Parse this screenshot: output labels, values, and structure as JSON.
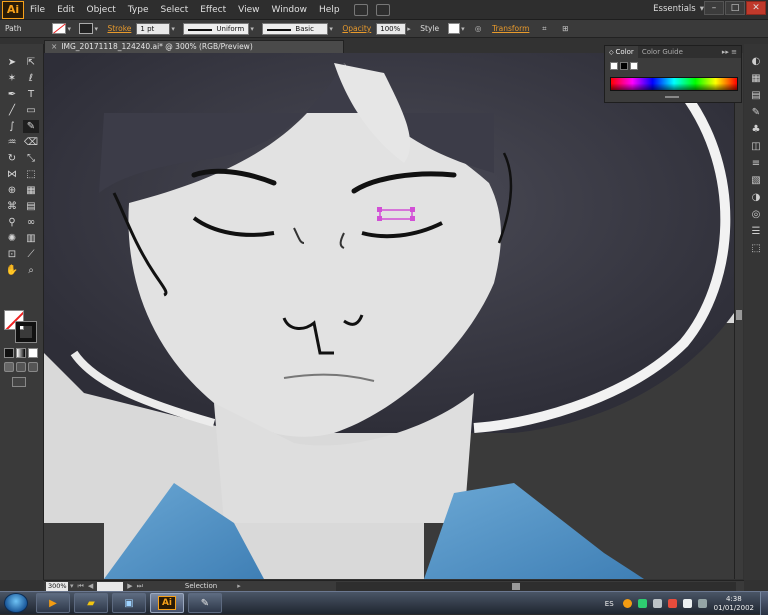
{
  "app": {
    "logo": "Ai",
    "menu": [
      "File",
      "Edit",
      "Object",
      "Type",
      "Select",
      "Effect",
      "View",
      "Window",
      "Help"
    ],
    "workspace": "Essentials",
    "window_buttons": [
      "–",
      "□",
      "✕"
    ]
  },
  "control_bar": {
    "object_type": "Path",
    "stroke_label": "Stroke",
    "stroke_weight": "1 pt",
    "profile": "Uniform",
    "brush": "Basic",
    "opacity_label": "Opacity",
    "opacity_value": "100%",
    "style_label": "Style",
    "transform_label": "Transform"
  },
  "document": {
    "tab_title": "IMG_20171118_124240.ai* @ 300% (RGB/Preview)",
    "close_glyph": "×"
  },
  "color_panel": {
    "tabs": [
      "Color",
      "Color Guide"
    ],
    "active_tab": "Color",
    "panel_controls": "▸▸ ≡"
  },
  "status_bar": {
    "zoom": "300%",
    "status_text": "Selection"
  },
  "taskbar": {
    "apps": [
      "media-player-icon",
      "file-explorer-icon",
      "screen-tool-icon",
      "illustrator-icon",
      "paint-icon"
    ],
    "ai_label": "Ai",
    "language": "ES",
    "time": "4:38",
    "date": "01/01/2002"
  },
  "colors": {
    "accent_orange": "#e89a2c",
    "illustrator_orange": "#f7a11a",
    "selection_magenta": "#d24fd6"
  }
}
